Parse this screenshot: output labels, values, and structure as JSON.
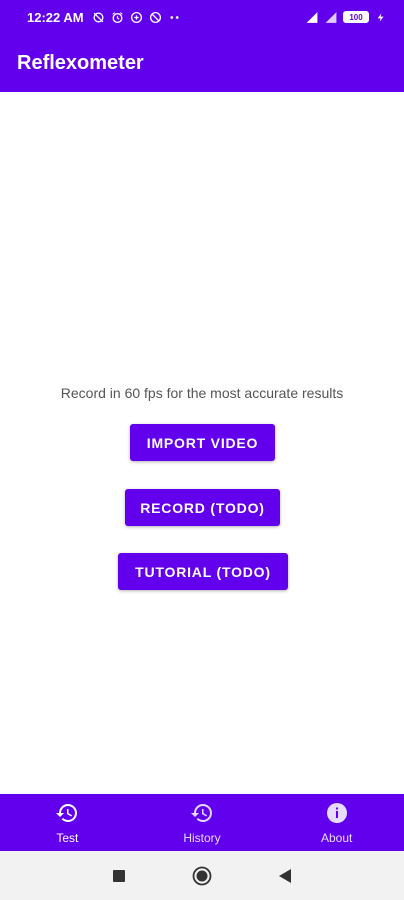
{
  "status_bar": {
    "time": "12:22 AM",
    "battery": "100",
    "left_icons": [
      "sync-off-icon",
      "alarm-icon",
      "vpn-icon",
      "data-saver-icon",
      "more-dots-icon"
    ],
    "right_icons": [
      "signal-icon",
      "wifi-icon",
      "battery-icon",
      "charging-icon"
    ]
  },
  "app_bar": {
    "title": "Reflexometer"
  },
  "main": {
    "hint": "Record in 60 fps for the most accurate results",
    "buttons": {
      "import": "IMPORT VIDEO",
      "record": "RECORD (TODO)",
      "tutorial": "TUTORIAL (TODO)"
    }
  },
  "bottom_nav": {
    "items": [
      {
        "label": "Test",
        "icon": "history-icon"
      },
      {
        "label": "History",
        "icon": "history-icon"
      },
      {
        "label": "About",
        "icon": "info-icon"
      }
    ]
  },
  "system_nav": {
    "buttons": [
      "recents-button",
      "home-button",
      "back-button"
    ]
  },
  "colors": {
    "primary": "#6200ee",
    "background": "#ffffff",
    "system_nav_bg": "#f2f2f2"
  }
}
